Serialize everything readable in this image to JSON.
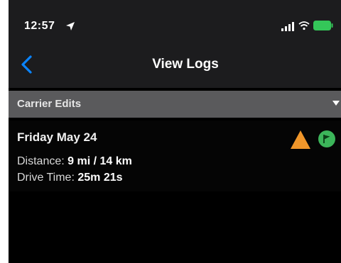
{
  "status_bar": {
    "time": "12:57",
    "icons": [
      "location-arrow-icon",
      "signal-icon",
      "wifi-icon",
      "battery-icon"
    ],
    "battery_color": "#34c759"
  },
  "nav": {
    "back_icon": "chevron-left-icon",
    "title": "View Logs",
    "accent_color": "#0a84ff"
  },
  "section": {
    "title": "Carrier Edits",
    "icon": "caret-down-icon"
  },
  "log_entry": {
    "date": "Friday May 24",
    "distance_label": "Distance:",
    "distance_value": "9 mi / 14 km",
    "drive_time_label": "Drive Time:",
    "drive_time_value": "25m 21s",
    "warning_icon": "warning-triangle-icon",
    "warning_color": "#f0962a",
    "status_icon": "flag-circle-icon",
    "status_color": "#3cb55a"
  }
}
